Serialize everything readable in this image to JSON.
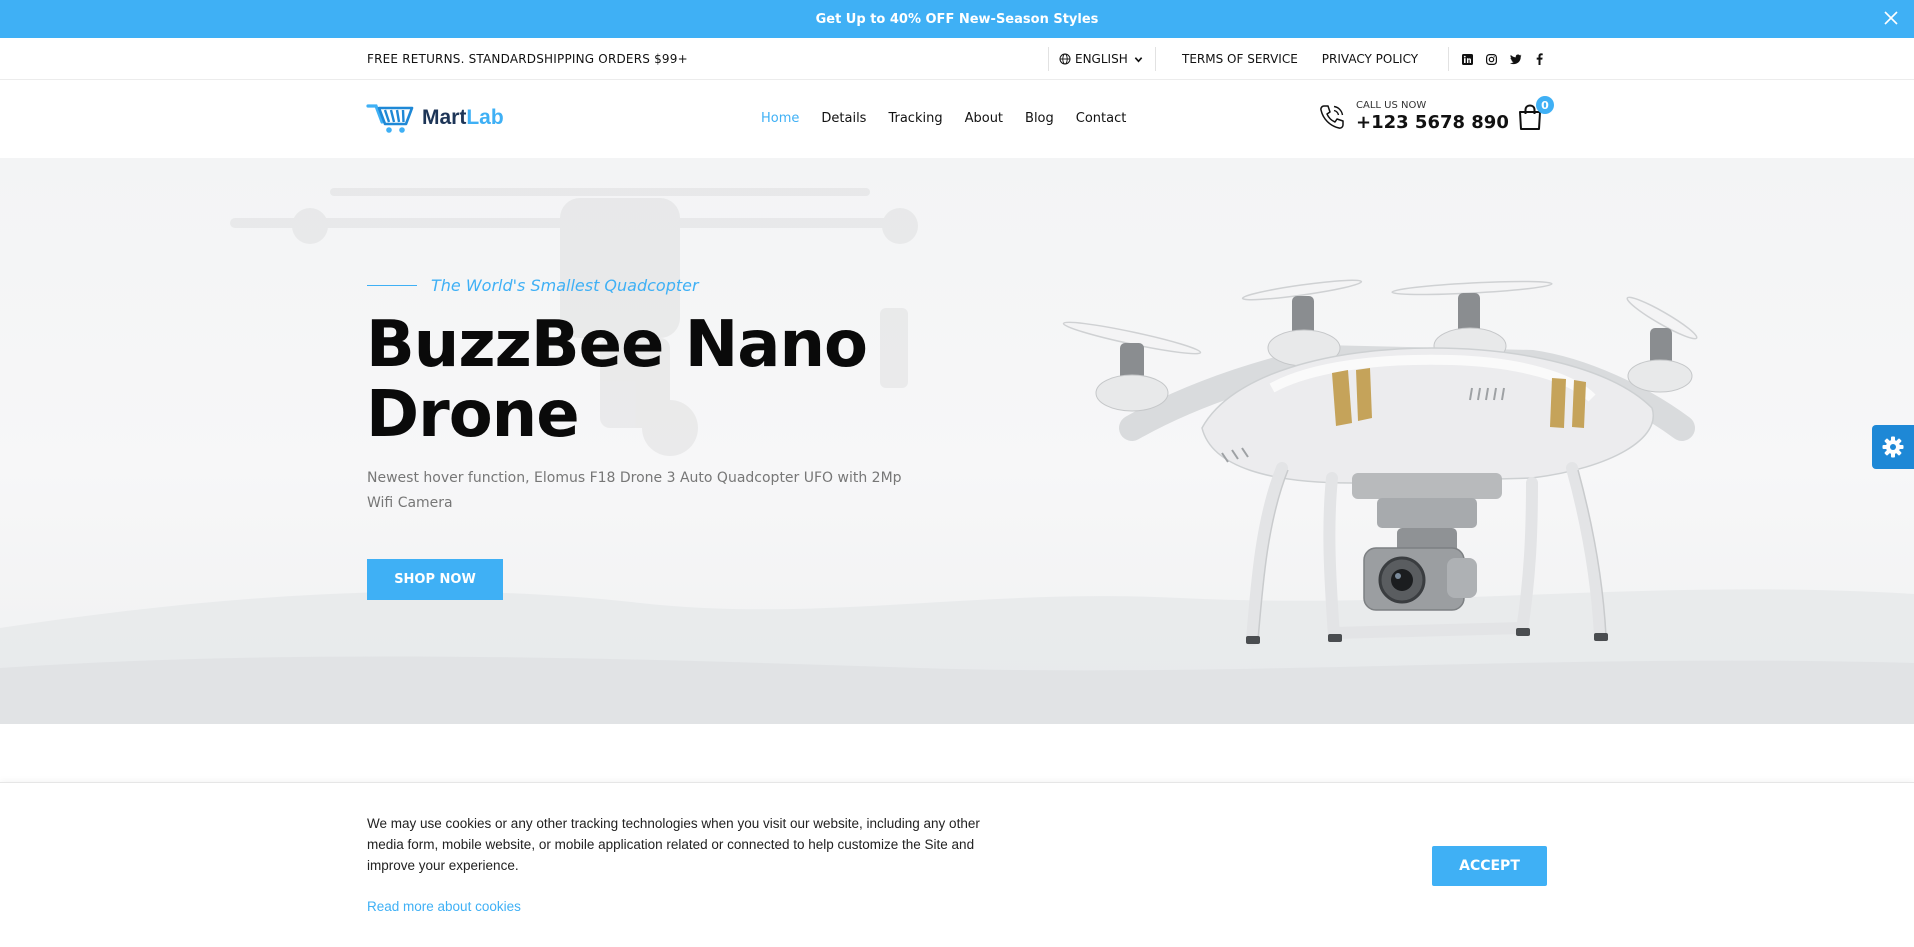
{
  "announcement": {
    "text": "Get Up to 40% OFF New-Season Styles",
    "close_icon": "close-icon"
  },
  "topbar": {
    "shipping": "FREE RETURNS. STANDARDSHIPPING ORDERS $99+",
    "language": "ENGLISH",
    "links": [
      "TERMS OF SERVICE",
      "PRIVACY POLICY"
    ],
    "social_icons": [
      "linkedin-icon",
      "instagram-icon",
      "twitter-icon",
      "facebook-icon"
    ]
  },
  "header": {
    "logo": {
      "part1": "Mart",
      "part2": "Lab"
    },
    "nav": [
      "Home",
      "Details",
      "Tracking",
      "About",
      "Blog",
      "Contact"
    ],
    "active_nav": "Home",
    "call_label": "CALL US NOW",
    "phone": "+123 5678 890",
    "cart_count": "0"
  },
  "hero": {
    "eyebrow": "The World's Smallest Quadcopter",
    "title": "BuzzBee Nano Drone",
    "description": "Newest hover function, Elomus F18 Drone 3 Auto Quadcopter UFO with 2Mp Wifi Camera",
    "cta": "SHOP NOW"
  },
  "cookie": {
    "text": "We may use cookies or any other tracking technologies when you visit our website, including any other media form, mobile website, or mobile application related or connected to help customize the Site and improve your experience.",
    "link": "Read more about cookies",
    "accept": "ACCEPT"
  },
  "colors": {
    "accent": "#3fb0f5",
    "dark": "#0a0a0a",
    "settings_tab": "#1e88d6"
  }
}
